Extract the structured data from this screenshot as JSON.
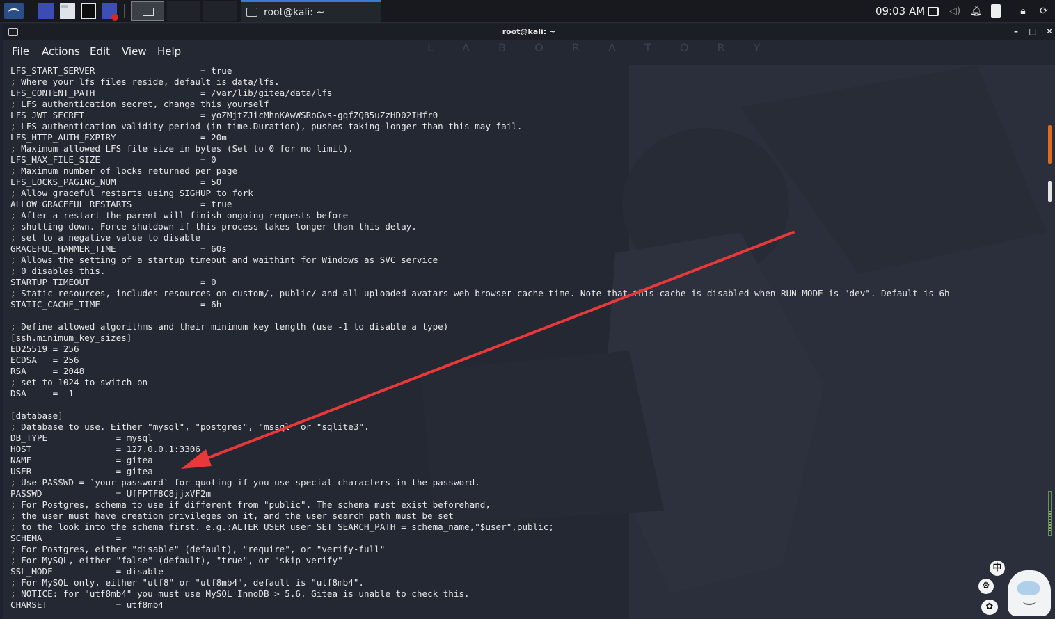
{
  "taskbar": {
    "task_title": "root@kali: ~",
    "clock": "09:03 AM",
    "icons": [
      "kali-menu-icon",
      "workspace-icon",
      "file-manager-icon",
      "terminal-icon",
      "screenshot-icon",
      "display-icon",
      "volume-icon",
      "notification-bell-icon",
      "battery-icon",
      "lock-icon",
      "refresh-icon"
    ]
  },
  "window": {
    "title": "root@kali: ~",
    "buttons": {
      "minimize": "–",
      "maximize": "□",
      "close": "✕"
    },
    "background_text": "L A B O R A T O R Y"
  },
  "menu": {
    "items": [
      "File",
      "Actions",
      "Edit",
      "View",
      "Help"
    ]
  },
  "terminal": {
    "lines": [
      "LFS_START_SERVER                    = true",
      "; Where your lfs files reside, default is data/lfs.",
      "LFS_CONTENT_PATH                    = /var/lib/gitea/data/lfs",
      "; LFS authentication secret, change this yourself",
      "LFS_JWT_SECRET                      = yoZMjtZJicMhnKAwWSRoGvs-gqfZQB5uZzHD02IHfr0",
      "; LFS authentication validity period (in time.Duration), pushes taking longer than this may fail.",
      "LFS_HTTP_AUTH_EXPIRY                = 20m",
      "; Maximum allowed LFS file size in bytes (Set to 0 for no limit).",
      "LFS_MAX_FILE_SIZE                   = 0",
      "; Maximum number of locks returned per page",
      "LFS_LOCKS_PAGING_NUM                = 50",
      "; Allow graceful restarts using SIGHUP to fork",
      "ALLOW_GRACEFUL_RESTARTS             = true",
      "; After a restart the parent will finish ongoing requests before",
      "; shutting down. Force shutdown if this process takes longer than this delay.",
      "; set to a negative value to disable",
      "GRACEFUL_HAMMER_TIME                = 60s",
      "; Allows the setting of a startup timeout and waithint for Windows as SVC service",
      "; 0 disables this.",
      "STARTUP_TIMEOUT                     = 0",
      "; Static resources, includes resources on custom/, public/ and all uploaded avatars web browser cache time. Note that this cache is disabled when RUN_MODE is \"dev\". Default is 6h",
      "STATIC_CACHE_TIME                   = 6h",
      "",
      "; Define allowed algorithms and their minimum key length (use -1 to disable a type)",
      "[ssh.minimum_key_sizes]",
      "ED25519 = 256",
      "ECDSA   = 256",
      "RSA     = 2048",
      "; set to 1024 to switch on",
      "DSA     = -1",
      "",
      "[database]",
      "; Database to use. Either \"mysql\", \"postgres\", \"mssql\" or \"sqlite3\".",
      "DB_TYPE             = mysql",
      "HOST                = 127.0.0.1:3306",
      "NAME                = gitea",
      "USER                = gitea",
      "; Use PASSWD = `your password` for quoting if you use special characters in the password.",
      "PASSWD              = UfFPTF8C8jjxVF2m",
      "; For Postgres, schema to use if different from \"public\". The schema must exist beforehand,",
      "; the user must have creation privileges on it, and the user search path must be set",
      "; to the look into the schema first. e.g.:ALTER USER user SET SEARCH_PATH = schema_name,\"$user\",public;",
      "SCHEMA              =",
      "; For Postgres, either \"disable\" (default), \"require\", or \"verify-full\"",
      "; For MySQL, either \"false\" (default), \"true\", or \"skip-verify\"",
      "SSL_MODE            = disable",
      "; For MySQL only, either \"utf8\" or \"utf8mb4\", default is \"utf8mb4\".",
      "; NOTICE: for \"utf8mb4\" you must use MySQL InnoDB > 5.6. Gitea is unable to check this.",
      "CHARSET             = utf8mb4"
    ]
  },
  "widgets": {
    "ime_label": "中",
    "gear_glyph": "⚙",
    "paw_glyph": "✿"
  },
  "colors": {
    "annotation_arrow": "#e8383a",
    "scroll_accent": "#e06b1b"
  }
}
